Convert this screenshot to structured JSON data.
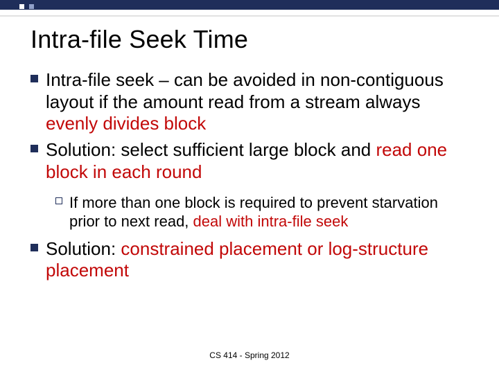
{
  "title": "Intra-file Seek Time",
  "bullets": {
    "b1a_part1": "Intra-file seek – can be avoided in non-contiguous layout if the amount read from a stream always ",
    "b1a_highlight": "evenly divides block",
    "b1b_part1": "Solution: select sufficient large block and ",
    "b1b_highlight": "read one block in each round",
    "b2_part1": "If more than one block is required to prevent starvation prior to next read, ",
    "b2_highlight": "deal with intra-file seek",
    "b1c_part1": "Solution: ",
    "b1c_highlight": "constrained placement or log-structure placement"
  },
  "footer": "CS 414 - Spring 2012"
}
